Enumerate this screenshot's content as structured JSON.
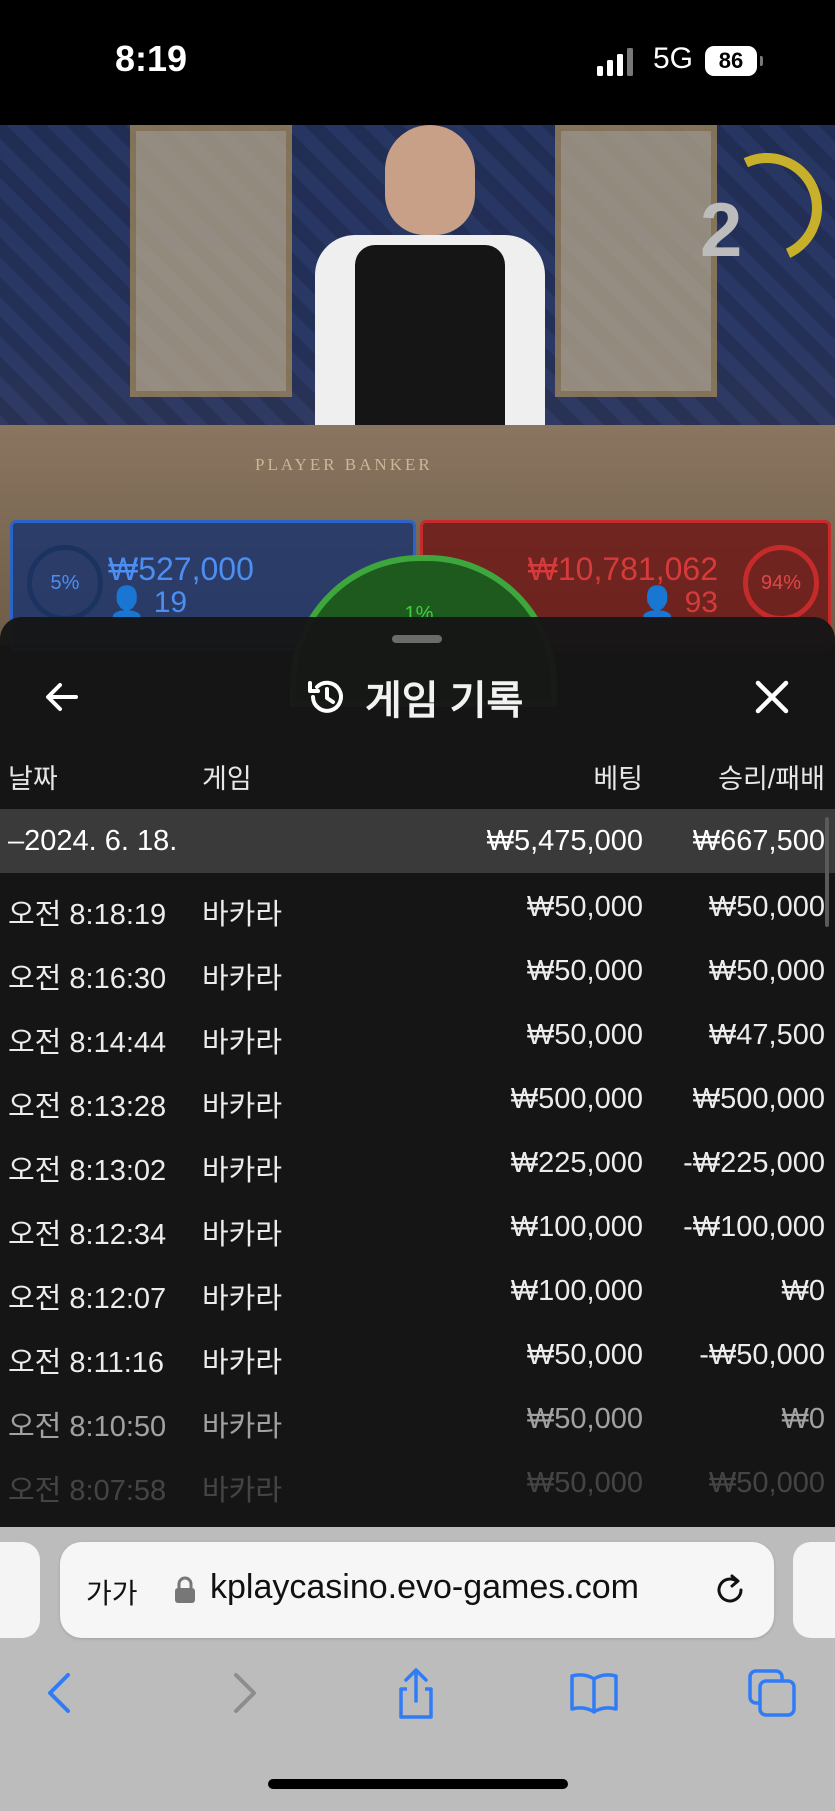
{
  "status_bar": {
    "time": "8:19",
    "network": "5G",
    "battery": "86"
  },
  "video": {
    "countdown": "2",
    "table_label": "PLAYER    BANKER",
    "player": {
      "percent": "5%",
      "amount": "₩527,000",
      "count": "19"
    },
    "tie": {
      "percent": "1%"
    },
    "banker": {
      "percent": "94%",
      "amount": "₩10,781,062",
      "count": "93"
    }
  },
  "panel": {
    "title": "게임 기록",
    "columns": {
      "date": "날짜",
      "game": "게임",
      "bet": "베팅",
      "win_loss": "승리/패배"
    },
    "date_group": {
      "date": "–2024. 6. 18.",
      "total_bet": "₩5,475,000",
      "total_win": "₩667,500"
    },
    "rows": [
      {
        "time": "오전 8:18:19",
        "game": "바카라",
        "bet": "₩50,000",
        "result": "₩50,000"
      },
      {
        "time": "오전 8:16:30",
        "game": "바카라",
        "bet": "₩50,000",
        "result": "₩50,000"
      },
      {
        "time": "오전 8:14:44",
        "game": "바카라",
        "bet": "₩50,000",
        "result": "₩47,500"
      },
      {
        "time": "오전 8:13:28",
        "game": "바카라",
        "bet": "₩500,000",
        "result": "₩500,000"
      },
      {
        "time": "오전 8:13:02",
        "game": "바카라",
        "bet": "₩225,000",
        "result": "-₩225,000"
      },
      {
        "time": "오전 8:12:34",
        "game": "바카라",
        "bet": "₩100,000",
        "result": "-₩100,000"
      },
      {
        "time": "오전 8:12:07",
        "game": "바카라",
        "bet": "₩100,000",
        "result": "₩0"
      },
      {
        "time": "오전 8:11:16",
        "game": "바카라",
        "bet": "₩50,000",
        "result": "-₩50,000"
      },
      {
        "time": "오전 8:10:50",
        "game": "바카라",
        "bet": "₩50,000",
        "result": "₩0"
      },
      {
        "time": "오전 8:07:58",
        "game": "바카라",
        "bet": "₩50,000",
        "result": "₩50,000"
      }
    ]
  },
  "browser": {
    "text_size_label": "가가",
    "url": "kplaycasino.evo-games.com"
  },
  "colors": {
    "player_blue": "#2b64c6",
    "banker_red": "#c62b2b",
    "tie_green": "#3da63d",
    "safari_blue": "#2f7cf6"
  }
}
